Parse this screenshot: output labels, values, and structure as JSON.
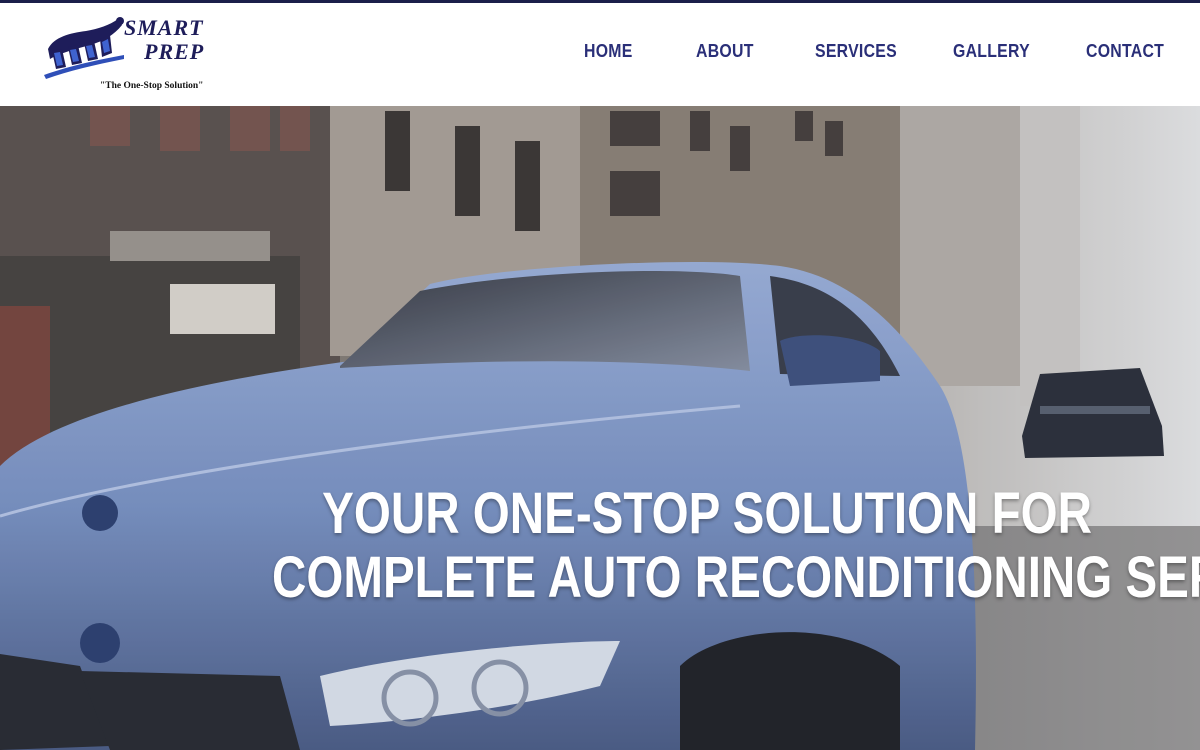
{
  "brand": {
    "name_line1": "SMART",
    "name_line2": "PREP",
    "tagline": "\"The One-Stop Solution\"",
    "logo_icon": "car-seat-logo-icon",
    "colors": {
      "navy": "#1e1d5a",
      "blue": "#2f4fb8"
    }
  },
  "nav": {
    "items": [
      {
        "label": "HOME"
      },
      {
        "label": "ABOUT"
      },
      {
        "label": "SERVICES"
      },
      {
        "label": "GALLERY"
      },
      {
        "label": "CONTACT"
      }
    ],
    "color": "#2a2f78"
  },
  "hero": {
    "title_line1": "YOUR ONE-STOP SOLUTION FOR",
    "title_line2": "COMPLETE AUTO RECONDITIONING SERVICES",
    "background": "blue sports car on city street photo",
    "car_color": "#6d86b8"
  }
}
